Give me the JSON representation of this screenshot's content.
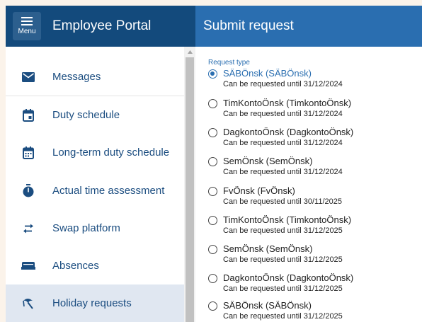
{
  "header": {
    "menu_label": "Menu",
    "portal_title": "Employee Portal",
    "page_title": "Submit request"
  },
  "colors": {
    "header_dark": "#134a7c",
    "header_accent": "#2a6eb0",
    "nav_text": "#1b4d80",
    "active_bg": "#e0e7f1"
  },
  "sidebar": {
    "items": [
      {
        "label": "Messages",
        "icon": "envelope-icon"
      },
      {
        "label": "Duty schedule",
        "icon": "calendar-icon"
      },
      {
        "label": "Long-term duty schedule",
        "icon": "calendar-dots-icon"
      },
      {
        "label": "Actual time assessment",
        "icon": "stopwatch-icon"
      },
      {
        "label": "Swap platform",
        "icon": "swap-arrows-icon"
      },
      {
        "label": "Absences",
        "icon": "bed-icon"
      },
      {
        "label": "Holiday requests",
        "icon": "beach-umbrella-icon",
        "active": true
      }
    ]
  },
  "form": {
    "field_label": "Request type",
    "selected_index": 0,
    "options": [
      {
        "name": "SÄBÖnsk (SÄBÖnsk)",
        "sub": "Can be requested until 31/12/2024"
      },
      {
        "name": "TimKontoÖnsk (TimkontoÖnsk)",
        "sub": "Can be requested until 31/12/2024"
      },
      {
        "name": "DagkontoÖnsk (DagkontoÖnsk)",
        "sub": "Can be requested until 31/12/2024"
      },
      {
        "name": "SemÖnsk (SemÖnsk)",
        "sub": "Can be requested until 31/12/2024"
      },
      {
        "name": "FvÖnsk (FvÖnsk)",
        "sub": "Can be requested until 30/11/2025"
      },
      {
        "name": "TimKontoÖnsk (TimkontoÖnsk)",
        "sub": "Can be requested until 31/12/2025"
      },
      {
        "name": "SemÖnsk (SemÖnsk)",
        "sub": "Can be requested until 31/12/2025"
      },
      {
        "name": "DagkontoÖnsk (DagkontoÖnsk)",
        "sub": "Can be requested until 31/12/2025"
      },
      {
        "name": "SÄBÖnsk (SÄBÖnsk)",
        "sub": "Can be requested until 31/12/2025"
      }
    ]
  }
}
